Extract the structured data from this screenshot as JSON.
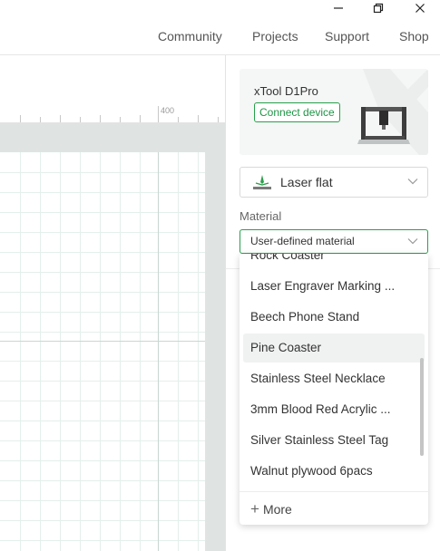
{
  "window": {
    "icons": {
      "minimize": "minimize-icon",
      "maximize": "maximize-icon",
      "close": "close-icon"
    }
  },
  "nav": {
    "items": [
      "Community",
      "Projects",
      "Support",
      "Shop"
    ]
  },
  "canvas": {
    "ruler_label": "400"
  },
  "device": {
    "name": "xTool D1Pro",
    "connect_label": "Connect device",
    "image": "laser-engraver-image"
  },
  "processing_mode": {
    "icon": "laser-flat-icon",
    "value": "Laser flat"
  },
  "material": {
    "label": "Material",
    "value": "User-defined material",
    "options": [
      "Rock Coaster",
      "Laser Engraver Marking ...",
      "Beech Phone Stand",
      "Pine Coaster",
      "Stainless Steel Necklace",
      "3mm Blood Red Acrylic ...",
      "Silver Stainless Steel Tag",
      "Walnut plywood 6pacs"
    ],
    "highlighted": "Pine Coaster",
    "more_label": "More"
  },
  "colors": {
    "accent": "#27a04b",
    "grid_line": "#d8e8e2",
    "workspace_bg": "#dfe3e1"
  }
}
